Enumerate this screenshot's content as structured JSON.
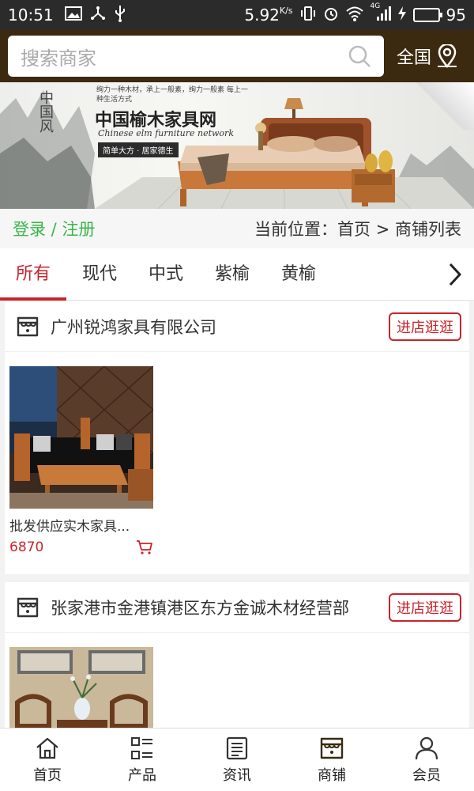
{
  "status_bar": {
    "time": "10:51",
    "speed": "5.92",
    "speed_unit": "K/s",
    "network": "4G",
    "battery": "95",
    "battery_level": 0.95
  },
  "header": {
    "search_placeholder": "搜索商家",
    "region_label": "全国"
  },
  "banner": {
    "title": "中国榆木家具网",
    "subtitle_en": "Chinese elm furniture network",
    "slogan": "简单大方 · 居家德生",
    "seal": "中国风",
    "poem": "绚力一种木材，承上一般素，绚力一般素 每上一种生活方式"
  },
  "location_row": {
    "login_label": "登录 / 注册",
    "breadcrumb": "当前位置：首页 > 商铺列表"
  },
  "tabs": [
    {
      "label": "所有",
      "active": true
    },
    {
      "label": "现代",
      "active": false
    },
    {
      "label": "中式",
      "active": false
    },
    {
      "label": "紫榆",
      "active": false
    },
    {
      "label": "黄榆",
      "active": false
    }
  ],
  "shops": [
    {
      "name": "广州锐鸿家具有限公司",
      "enter_label": "进店逛逛",
      "products": [
        {
          "name": "批发供应实木家具...",
          "price": "6870"
        }
      ]
    },
    {
      "name": "张家港市金港镇港区东方金诚木材经营部",
      "enter_label": "进店逛逛",
      "products": [
        {
          "name": "",
          "price": ""
        }
      ]
    }
  ],
  "bottom_nav": [
    {
      "label": "首页",
      "icon": "home-icon"
    },
    {
      "label": "产品",
      "icon": "grid-list-icon"
    },
    {
      "label": "资讯",
      "icon": "news-icon"
    },
    {
      "label": "商铺",
      "icon": "store-icon"
    },
    {
      "label": "会员",
      "icon": "user-icon"
    }
  ],
  "colors": {
    "accent_red": "#c8242b",
    "login_green": "#3bb54a",
    "header_brown": "#3b2a10",
    "status_bar": "#2b2b2b"
  }
}
